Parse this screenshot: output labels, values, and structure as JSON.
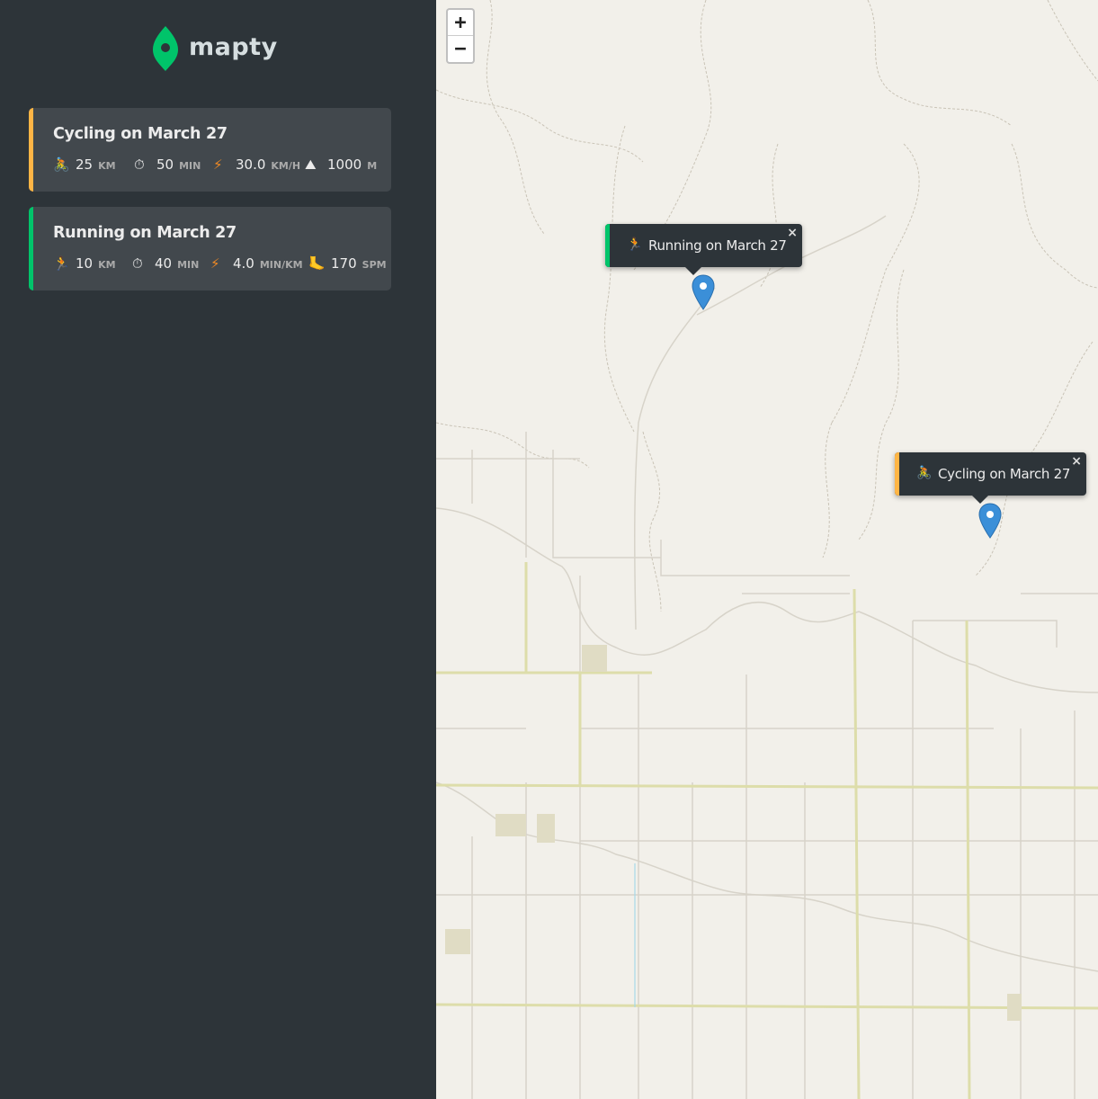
{
  "app": {
    "name": "mapty"
  },
  "colors": {
    "running": "#00c46a",
    "cycling": "#ffb545",
    "sidebar_bg": "#2d3439",
    "card_bg": "#42484d",
    "marker": "#3b8fd8"
  },
  "workouts": [
    {
      "type": "cycling",
      "title": "Cycling on March 27",
      "details": [
        {
          "icon": "cyclist-icon",
          "glyph": "🚴",
          "value": "25",
          "unit": "KM"
        },
        {
          "icon": "stopwatch-icon",
          "glyph": "⏱",
          "value": "50",
          "unit": "MIN"
        },
        {
          "icon": "lightning-icon",
          "glyph": "⚡",
          "value": "30.0",
          "unit": "KM/H"
        },
        {
          "icon": "mountain-icon",
          "glyph": "⛰",
          "value": "1000",
          "unit": "M"
        }
      ]
    },
    {
      "type": "running",
      "title": "Running on March 27",
      "details": [
        {
          "icon": "runner-icon",
          "glyph": "🏃",
          "value": "10",
          "unit": "KM"
        },
        {
          "icon": "stopwatch-icon",
          "glyph": "⏱",
          "value": "40",
          "unit": "MIN"
        },
        {
          "icon": "lightning-icon",
          "glyph": "⚡",
          "value": "4.0",
          "unit": "MIN/KM"
        },
        {
          "icon": "footprint-icon",
          "glyph": "🦶",
          "value": "170",
          "unit": "SPM"
        }
      ]
    }
  ],
  "map": {
    "zoom_in": "+",
    "zoom_out": "−",
    "popups": [
      {
        "type": "running",
        "glyph": "🏃",
        "text": "Running on March 27",
        "close": "×"
      },
      {
        "type": "cycling",
        "glyph": "🚴",
        "text": "Cycling on March 27",
        "close": "×"
      }
    ]
  }
}
